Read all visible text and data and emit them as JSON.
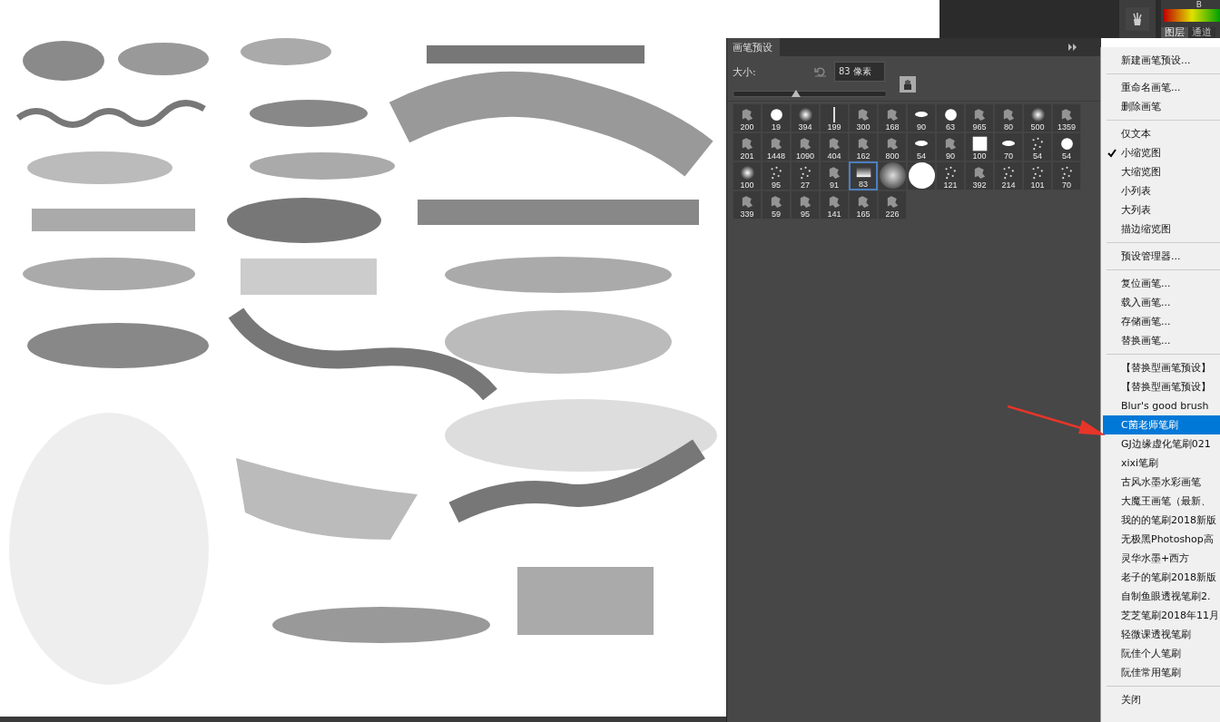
{
  "top_panel": {
    "channel_label": "B",
    "tabs": [
      {
        "label": "图层",
        "selected": true
      },
      {
        "label": "通道",
        "selected": false
      }
    ]
  },
  "brush_panel": {
    "tab": "画笔预设",
    "size_label": "大小:",
    "size_value": "83 像素",
    "size_slider": {
      "level": 0.41
    },
    "brushes": [
      {
        "label": "200",
        "kind": "texture",
        "selected": false
      },
      {
        "label": "19",
        "kind": "hard",
        "selected": false
      },
      {
        "label": "394",
        "kind": "soft",
        "selected": false
      },
      {
        "label": "199",
        "kind": "line",
        "selected": false
      },
      {
        "label": "300",
        "kind": "texture",
        "selected": false
      },
      {
        "label": "168",
        "kind": "texture",
        "selected": false
      },
      {
        "label": "90",
        "kind": "ellipse",
        "selected": false
      },
      {
        "label": "63",
        "kind": "hard",
        "selected": false
      },
      {
        "label": "965",
        "kind": "texture",
        "selected": false
      },
      {
        "label": "80",
        "kind": "texture",
        "selected": false
      },
      {
        "label": "500",
        "kind": "soft",
        "selected": false
      },
      {
        "label": "1359",
        "kind": "texture",
        "selected": false
      },
      {
        "label": "201",
        "kind": "texture",
        "selected": false
      },
      {
        "label": "1448",
        "kind": "texture",
        "selected": false
      },
      {
        "label": "1090",
        "kind": "texture",
        "selected": false
      },
      {
        "label": "404",
        "kind": "texture",
        "selected": false
      },
      {
        "label": "162",
        "kind": "texture",
        "selected": false
      },
      {
        "label": "800",
        "kind": "texture",
        "selected": false
      },
      {
        "label": "54",
        "kind": "ellipse",
        "selected": false
      },
      {
        "label": "90",
        "kind": "texture",
        "selected": false
      },
      {
        "label": "100",
        "kind": "square",
        "selected": false
      },
      {
        "label": "70",
        "kind": "ellipse",
        "selected": false
      },
      {
        "label": "54",
        "kind": "dots",
        "selected": false
      },
      {
        "label": "54",
        "kind": "hard",
        "selected": false
      },
      {
        "label": "100",
        "kind": "soft",
        "selected": false
      },
      {
        "label": "95",
        "kind": "dots",
        "selected": false
      },
      {
        "label": "27",
        "kind": "dots",
        "selected": false
      },
      {
        "label": "91",
        "kind": "texture",
        "selected": false
      },
      {
        "label": "83",
        "kind": "gradient",
        "selected": true
      },
      {
        "kind": "big-soft",
        "selected": false
      },
      {
        "kind": "big-hard",
        "selected": false
      },
      {
        "label": "121",
        "kind": "dots",
        "selected": false
      },
      {
        "label": "392",
        "kind": "texture",
        "selected": false
      },
      {
        "label": "214",
        "kind": "dots",
        "selected": false
      },
      {
        "label": "101",
        "kind": "dots",
        "selected": false
      },
      {
        "label": "70",
        "kind": "dots",
        "selected": false
      },
      {
        "label": "339",
        "kind": "texture",
        "selected": false
      },
      {
        "label": "59",
        "kind": "texture",
        "selected": false
      },
      {
        "label": "95",
        "kind": "texture",
        "selected": false
      },
      {
        "label": "141",
        "kind": "texture",
        "selected": false
      },
      {
        "label": "165",
        "kind": "texture",
        "selected": false
      },
      {
        "label": "226",
        "kind": "texture",
        "selected": false
      }
    ]
  },
  "menu": {
    "sections": [
      {
        "items": [
          {
            "label": "新建画笔预设...",
            "selected": false
          }
        ]
      },
      {
        "items": [
          {
            "label": "重命名画笔...",
            "selected": false
          },
          {
            "label": "删除画笔",
            "selected": false
          }
        ]
      },
      {
        "items": [
          {
            "label": "仅文本",
            "selected": false,
            "checked": false
          },
          {
            "label": "小缩览图",
            "selected": false,
            "checked": true
          },
          {
            "label": "大缩览图",
            "selected": false,
            "checked": false
          },
          {
            "label": "小列表",
            "selected": false,
            "checked": false
          },
          {
            "label": "大列表",
            "selected": false,
            "checked": false
          },
          {
            "label": "描边缩览图",
            "selected": false,
            "checked": false
          }
        ]
      },
      {
        "items": [
          {
            "label": "预设管理器...",
            "selected": false
          }
        ]
      },
      {
        "items": [
          {
            "label": "复位画笔...",
            "selected": false
          },
          {
            "label": "载入画笔...",
            "selected": false
          },
          {
            "label": "存储画笔...",
            "selected": false
          },
          {
            "label": "替换画笔...",
            "selected": false
          }
        ]
      },
      {
        "items": [
          {
            "label": "【替换型画笔预设】",
            "selected": false
          },
          {
            "label": "【替换型画笔预设】",
            "selected": false
          },
          {
            "label": "Blur's good brush",
            "selected": false
          },
          {
            "label": "C菌老师笔刷",
            "selected": true
          },
          {
            "label": "GJ边缘虚化笔刷021",
            "selected": false
          },
          {
            "label": "xixi笔刷",
            "selected": false
          },
          {
            "label": "古风水墨水彩画笔",
            "selected": false
          },
          {
            "label": "大魔王画笔（最新、",
            "selected": false
          },
          {
            "label": "我的的笔刷2018新版",
            "selected": false
          },
          {
            "label": "无极黑Photoshop高",
            "selected": false
          },
          {
            "label": "灵华水墨+西方",
            "selected": false
          },
          {
            "label": "老子的笔刷2018新版",
            "selected": false
          },
          {
            "label": "自制鱼眼透视笔刷2.",
            "selected": false
          },
          {
            "label": "芝芝笔刷2018年11月",
            "selected": false
          },
          {
            "label": "轻微课透视笔刷",
            "selected": false
          },
          {
            "label": "阮佳个人笔刷",
            "selected": false
          },
          {
            "label": "阮佳常用笔刷",
            "selected": false
          }
        ]
      },
      {
        "items": [
          {
            "label": "关闭",
            "selected": false
          }
        ]
      }
    ]
  }
}
